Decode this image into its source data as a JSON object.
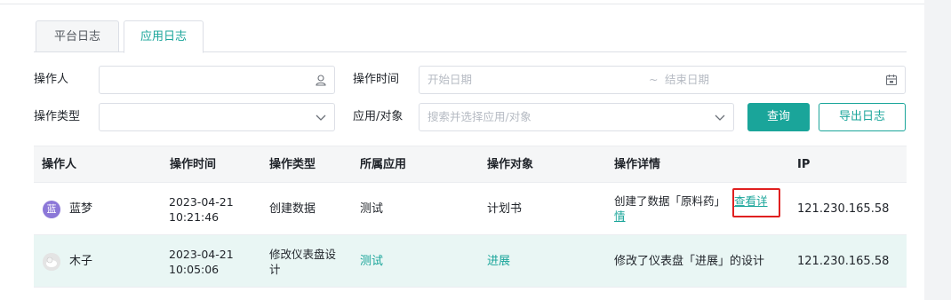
{
  "tabs": [
    {
      "label": "平台日志",
      "active": false
    },
    {
      "label": "应用日志",
      "active": true
    }
  ],
  "filters": {
    "operator_label": "操作人",
    "operator_value": "",
    "time_label": "操作时间",
    "start_placeholder": "开始日期",
    "separator": "~",
    "end_placeholder": "结束日期",
    "type_label": "操作类型",
    "type_value": "",
    "target_label": "应用/对象",
    "target_placeholder": "搜索并选择应用/对象",
    "query_button": "查询",
    "export_button": "导出日志"
  },
  "table": {
    "headers": [
      "操作人",
      "操作时间",
      "操作类型",
      "所属应用",
      "操作对象",
      "操作详情",
      "IP"
    ],
    "rows": [
      {
        "avatar_text": "蓝",
        "operator": "蓝梦",
        "date": "2023-04-21",
        "time": "10:21:46",
        "type": "创建数据",
        "app": "测试",
        "target": "计划书",
        "detail": "创建了数据「原料药」",
        "detail_link_1": "查看详",
        "detail_link_2": "情",
        "ip": "121.230.165.58"
      },
      {
        "avatar_text": "",
        "operator": "木子",
        "date": "2023-04-21",
        "time": "10:05:06",
        "type_line1": "修改仪表盘设",
        "type_line2": "计",
        "app": "测试",
        "target": "进展",
        "detail": "修改了仪表盘「进展」的设计",
        "ip": "121.230.165.58"
      }
    ]
  },
  "colors": {
    "accent": "#1aa59a",
    "highlight": "#e02020",
    "row_selected": "#e9f6f4"
  },
  "icons": [
    "user-icon",
    "calendar-icon",
    "chevron-down-icon"
  ]
}
